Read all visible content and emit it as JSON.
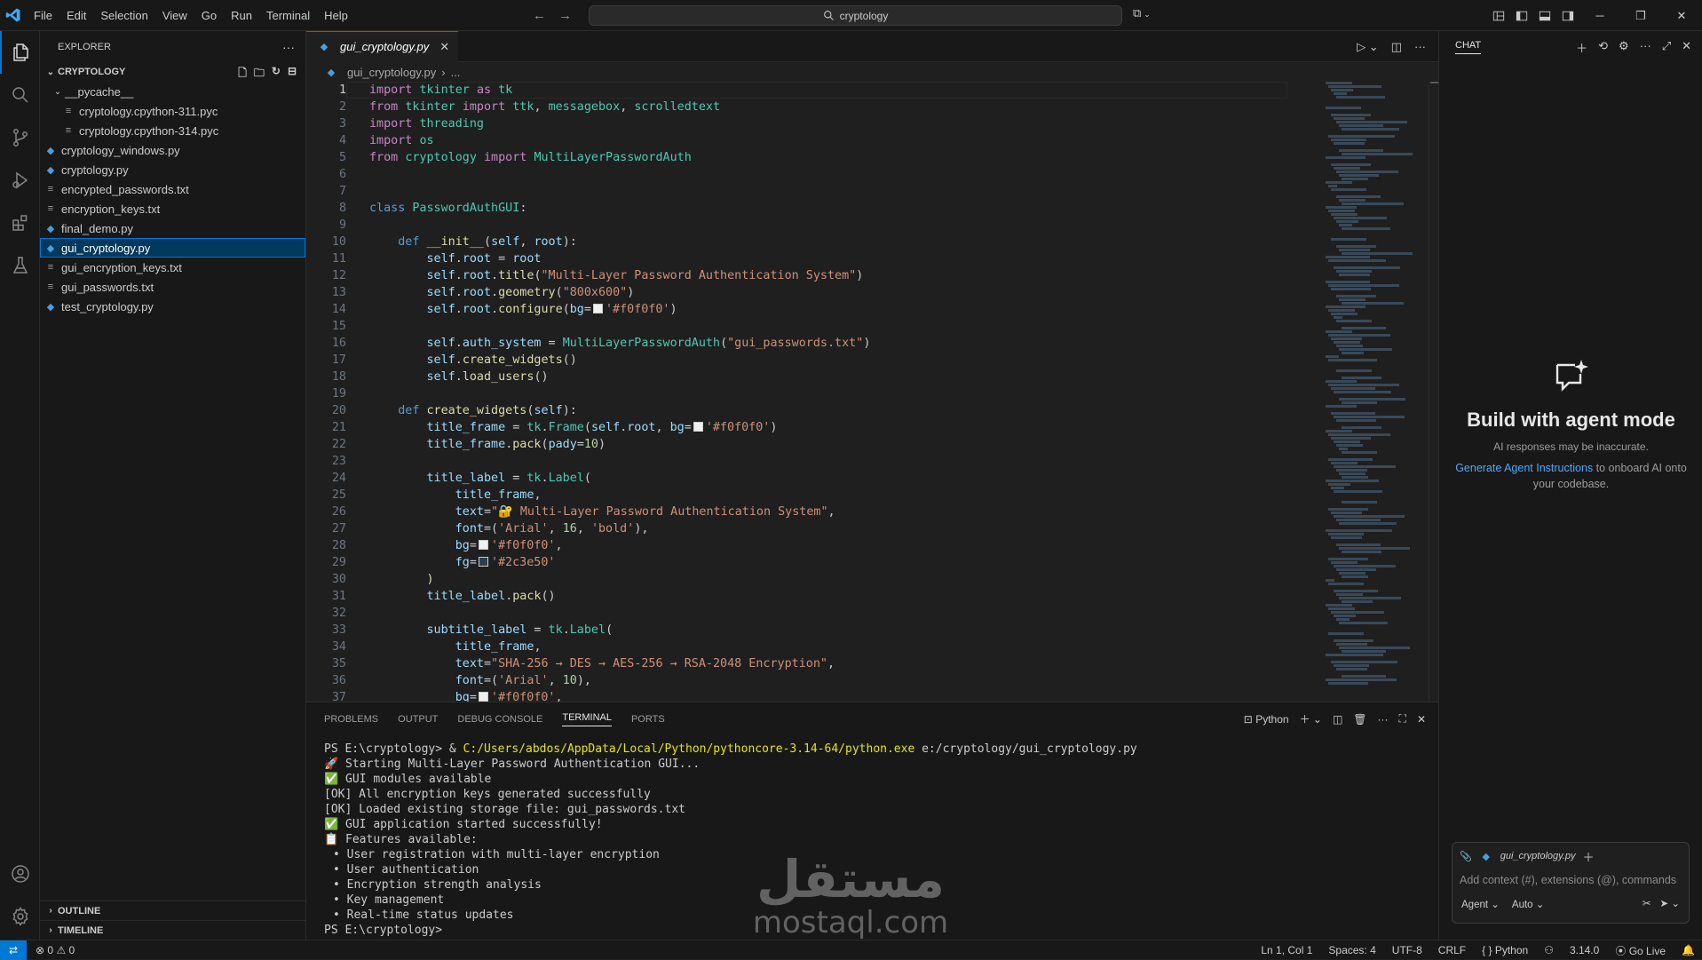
{
  "menu": [
    "File",
    "Edit",
    "Selection",
    "View",
    "Go",
    "Run",
    "Terminal",
    "Help"
  ],
  "search": {
    "text": "cryptology"
  },
  "explorer": {
    "title": "EXPLORER",
    "folder": "CRYPTOLOGY",
    "items": [
      {
        "label": "__pycache__",
        "type": "folder",
        "indent": 1
      },
      {
        "label": "cryptology.cpython-311.pyc",
        "type": "pyc",
        "indent": 2
      },
      {
        "label": "cryptology.cpython-314.pyc",
        "type": "pyc",
        "indent": 2
      },
      {
        "label": "cryptology_windows.py",
        "type": "py",
        "indent": 1
      },
      {
        "label": "cryptology.py",
        "type": "py",
        "indent": 1
      },
      {
        "label": "encrypted_passwords.txt",
        "type": "txt",
        "indent": 1
      },
      {
        "label": "encryption_keys.txt",
        "type": "txt",
        "indent": 1
      },
      {
        "label": "final_demo.py",
        "type": "py",
        "indent": 1
      },
      {
        "label": "gui_cryptology.py",
        "type": "py",
        "indent": 1,
        "selected": true
      },
      {
        "label": "gui_encryption_keys.txt",
        "type": "txt",
        "indent": 1
      },
      {
        "label": "gui_passwords.txt",
        "type": "txt",
        "indent": 1
      },
      {
        "label": "test_cryptology.py",
        "type": "py",
        "indent": 1
      }
    ],
    "outline": "OUTLINE",
    "timeline": "TIMELINE"
  },
  "editor": {
    "tab": "gui_cryptology.py",
    "breadcrumb_file": "gui_cryptology.py",
    "breadcrumb_more": "..."
  },
  "panel": {
    "tabs": [
      "PROBLEMS",
      "OUTPUT",
      "DEBUG CONSOLE",
      "TERMINAL",
      "PORTS"
    ],
    "active_tab": "TERMINAL",
    "shell": "Python",
    "prompt": "PS E:\\cryptology>",
    "command_amp": "&",
    "command_exe": "C:/Users/abdos/AppData/Local/Python/pythoncore-3.14-64/python.exe",
    "command_arg": "e:/cryptology/gui_cryptology.py",
    "output": [
      "🚀 Starting Multi-Layer Password Authentication GUI...",
      "✅ GUI modules available",
      "[OK] All encryption keys generated successfully",
      "[OK] Loaded existing storage file: gui_passwords.txt",
      "✅ GUI application started successfully!",
      "📋 Features available:",
      "• User registration with multi-layer encryption",
      "• User authentication",
      "• Encryption strength analysis",
      "• Key management",
      "• Real-time status updates"
    ],
    "final_prompt": "PS E:\\cryptology>"
  },
  "chat": {
    "title": "CHAT",
    "heading": "Build with agent mode",
    "disclaimer": "AI responses may be inaccurate.",
    "link": "Generate Agent Instructions",
    "link_rest": "to onboard AI onto your codebase.",
    "context_file": "gui_cryptology.py",
    "placeholder": "Add context (#), extensions (@), commands",
    "mode": "Agent",
    "model": "Auto"
  },
  "status": {
    "errors": "0",
    "warnings": "0",
    "position": "Ln 1, Col 1",
    "spaces": "Spaces: 4",
    "encoding": "UTF-8",
    "eol": "CRLF",
    "language": "Python",
    "version": "3.14.0",
    "golive": "Go Live"
  },
  "watermark": {
    "arabic": "مستقل",
    "latin": "mostaql.com"
  },
  "colors": {
    "accent": "#0078d4",
    "bg": "#1f1f1f",
    "sidebar": "#181818"
  }
}
